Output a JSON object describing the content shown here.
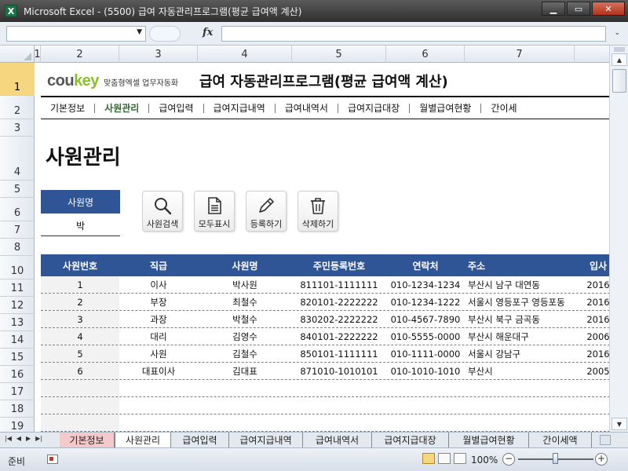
{
  "window": {
    "title": "Microsoft Excel - (5500) 급여 자동관리프로그램(평균 급여액 계산)",
    "app_icon": "X",
    "controls": [
      "minimize-icon",
      "maximize-icon",
      "close-icon"
    ]
  },
  "formula_bar": {
    "name_box": "",
    "fx_label": "fx",
    "formula": ""
  },
  "grid": {
    "columns": [
      "1",
      "2",
      "3",
      "4",
      "5",
      "6",
      "7"
    ],
    "rows": [
      "1",
      "2",
      "3",
      "4",
      "5",
      "6",
      "7",
      "8",
      "10",
      "11",
      "12",
      "13",
      "14",
      "15",
      "16",
      "17",
      "18",
      "19"
    ],
    "selected_row": "1"
  },
  "brand": {
    "logo_part1": "cou",
    "logo_part2": "key",
    "tagline": "맞춤형엑셀 업무자동화",
    "logo_accent_color": "#8cbf2f"
  },
  "doc_title": "급여 자동관리프로그램(평균 급여액 계산)",
  "menu": {
    "items": [
      "기본정보",
      "사원관리",
      "급여입력",
      "급여지급내역",
      "급여내역서",
      "급여지급대장",
      "월별급여현황",
      "간이세"
    ],
    "active_index": 1,
    "active_color": "#2f6a2f"
  },
  "page_title": "사원관리",
  "filter": {
    "label": "사원명",
    "value": "박"
  },
  "actions": [
    {
      "label": "사원검색",
      "icon": "search-icon"
    },
    {
      "label": "모두표시",
      "icon": "document-icon"
    },
    {
      "label": "등록하기",
      "icon": "pencil-icon"
    },
    {
      "label": "삭제하기",
      "icon": "trash-icon"
    }
  ],
  "table": {
    "header_color": "#2f5597",
    "headers": [
      "사원번호",
      "직급",
      "사원명",
      "주민등록번호",
      "연락처",
      "주소",
      "입사"
    ],
    "rows": [
      [
        "1",
        "이사",
        "박사원",
        "811101-1111111",
        "010-1234-1234",
        "부산시 남구 대연동",
        "2016"
      ],
      [
        "2",
        "부장",
        "최철수",
        "820101-2222222",
        "010-1234-1222",
        "서울시 영등포구 영등포동",
        "2016"
      ],
      [
        "3",
        "과장",
        "박철수",
        "830202-2222222",
        "010-4567-7890",
        "부산시 북구 금곡동",
        "2016"
      ],
      [
        "4",
        "대리",
        "김영수",
        "840101-2222222",
        "010-5555-0000",
        "부산시 해운대구",
        "2006"
      ],
      [
        "5",
        "사원",
        "김철수",
        "850101-1111111",
        "010-1111-0000",
        "서울시 강남구",
        "2016"
      ],
      [
        "6",
        "대표이사",
        "김대표",
        "871010-1010101",
        "010-1010-1010",
        "부산시",
        "2005"
      ],
      [
        "",
        "",
        "",
        "",
        "",
        "",
        ""
      ],
      [
        "",
        "",
        "",
        "",
        "",
        "",
        ""
      ],
      [
        "",
        "",
        "",
        "",
        "",
        "",
        ""
      ]
    ]
  },
  "sheet_tabs": {
    "tabs": [
      "기본정보",
      "사원관리",
      "급여입력",
      "급여지급내역",
      "급여내역서",
      "급여지급대장",
      "월별급여현황",
      "간이세액"
    ],
    "active_index": 1
  },
  "status": {
    "ready": "준비",
    "zoom": "100%",
    "zoom_fraction": 0.5
  }
}
